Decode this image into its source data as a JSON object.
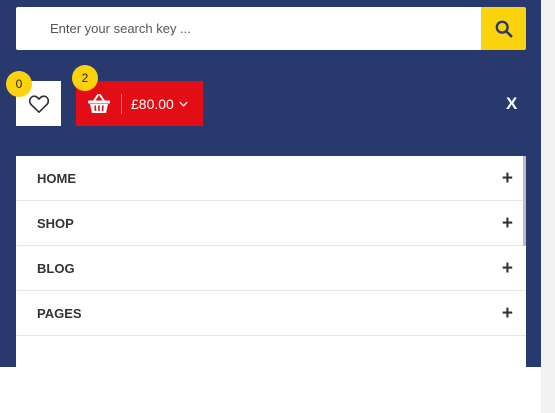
{
  "search": {
    "placeholder": "Enter your search key ...",
    "value": "",
    "icon": "search-icon",
    "button_color": "#fad30c"
  },
  "wishlist": {
    "count": "0",
    "icon": "heart-icon"
  },
  "cart": {
    "count": "2",
    "total": "£80.00",
    "icon": "basket-icon",
    "color": "#e30e15"
  },
  "close": {
    "label": "X"
  },
  "menu": {
    "items": [
      {
        "label": "HOME",
        "expand": "+"
      },
      {
        "label": "SHOP",
        "expand": "+"
      },
      {
        "label": "BLOG",
        "expand": "+"
      },
      {
        "label": "PAGES",
        "expand": "+"
      }
    ]
  },
  "colors": {
    "panel_bg": "#283a6d",
    "badge": "#fad30c"
  }
}
